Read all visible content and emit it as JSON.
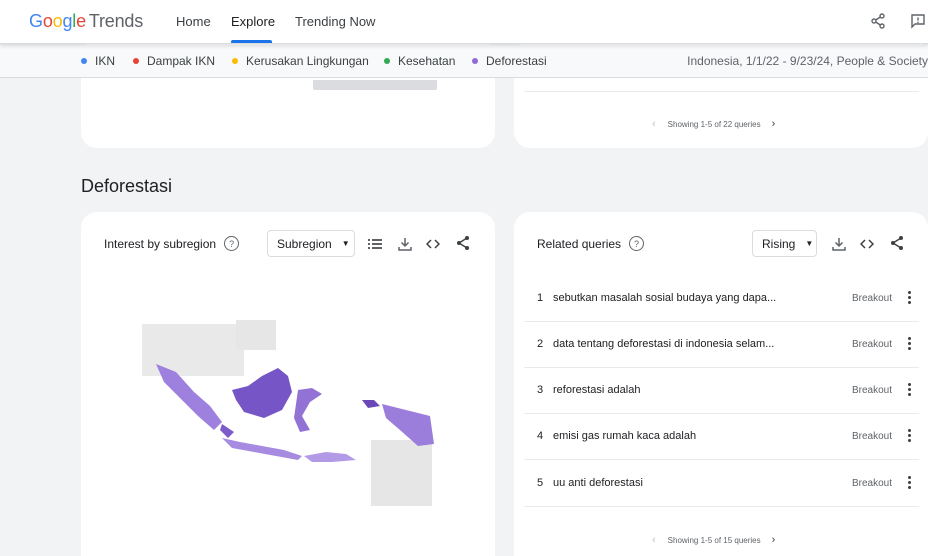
{
  "header": {
    "logo_google": [
      "G",
      "o",
      "o",
      "g",
      "l",
      "e"
    ],
    "logo_trends": "Trends",
    "nav": [
      "Home",
      "Explore",
      "Trending Now"
    ],
    "active_nav": "Explore",
    "share_icon": "share-icon",
    "feedback_icon": "feedback-icon"
  },
  "legend": {
    "terms": [
      {
        "label": "IKN",
        "color": "#4285f4"
      },
      {
        "label": "Dampak IKN",
        "color": "#ea4335"
      },
      {
        "label": "Kerusakan Lingkungan",
        "color": "#fbbc04"
      },
      {
        "label": "Kesehatan",
        "color": "#34a853"
      },
      {
        "label": "Deforestasi",
        "color": "#8e6bd8"
      }
    ],
    "meta": "Indonesia, 1/1/22 - 9/23/24, People & Society"
  },
  "top_cards": {
    "pager_text": "Showing 1-5 of 22 queries"
  },
  "section": {
    "title": "Deforestasi"
  },
  "subregion_card": {
    "label": "Interest by subregion",
    "select_value": "Subregion",
    "map_color": "#8e6bd8"
  },
  "queries_card": {
    "label": "Related queries",
    "select_value": "Rising",
    "rows": [
      {
        "num": "1",
        "query": "sebutkan masalah sosial budaya yang dapa...",
        "value": "Breakout"
      },
      {
        "num": "2",
        "query": "data tentang deforestasi di indonesia selam...",
        "value": "Breakout"
      },
      {
        "num": "3",
        "query": "reforestasi adalah",
        "value": "Breakout"
      },
      {
        "num": "4",
        "query": "emisi gas rumah kaca adalah",
        "value": "Breakout"
      },
      {
        "num": "5",
        "query": "uu anti deforestasi",
        "value": "Breakout"
      }
    ],
    "pager_text": "Showing 1-5 of 15 queries"
  }
}
